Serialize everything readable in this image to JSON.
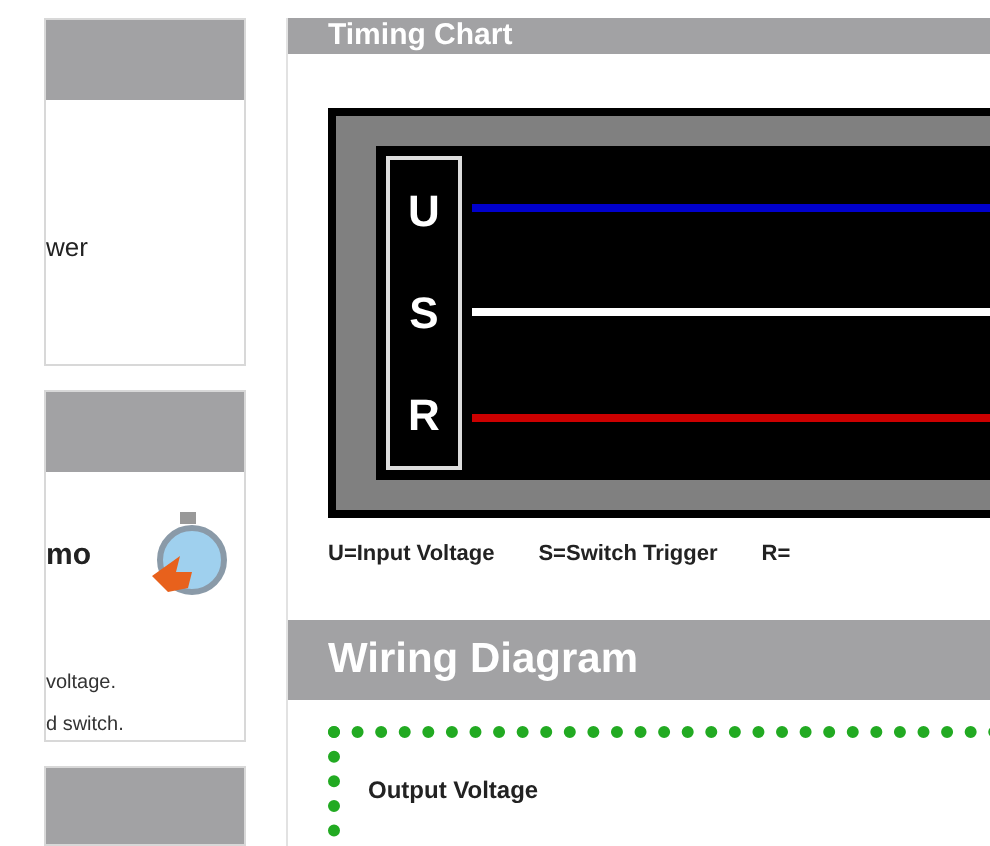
{
  "left_panels": [
    {
      "lines": [
        "wer"
      ],
      "icon": false
    },
    {
      "lines": [
        "mo"
      ],
      "icon": true,
      "notes": [
        "voltage.",
        "d switch."
      ]
    }
  ],
  "timing_chart": {
    "title": "Timing Chart",
    "signals": [
      {
        "letter": "U",
        "color": "#0000cc"
      },
      {
        "letter": "S",
        "color": "#ffffff"
      },
      {
        "letter": "R",
        "color": "#cc0000"
      }
    ],
    "legend": [
      "U=Input Voltage",
      "S=Switch Trigger",
      "R="
    ]
  },
  "wiring_diagram": {
    "title": "Wiring Diagram",
    "label": "Output Voltage"
  }
}
